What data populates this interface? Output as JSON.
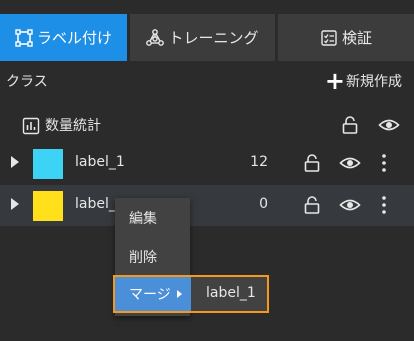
{
  "tabs": {
    "labeling": "ラベル付け",
    "training": "トレーニング",
    "verify": "検証"
  },
  "class_panel": {
    "title": "クラス",
    "new_button": "新規作成"
  },
  "stats": {
    "label": "数量統計"
  },
  "classes": [
    {
      "name": "label_1",
      "count": "12",
      "color": "#3dd3f5"
    },
    {
      "name": "label_",
      "count": "0",
      "color": "#ffe01a"
    }
  ],
  "context_menu": {
    "edit": "編集",
    "delete": "削除",
    "merge": "マージ",
    "merge_target": "label_1"
  },
  "colors": {
    "accent": "#1e8fe6",
    "highlight": "#f39a1e"
  }
}
